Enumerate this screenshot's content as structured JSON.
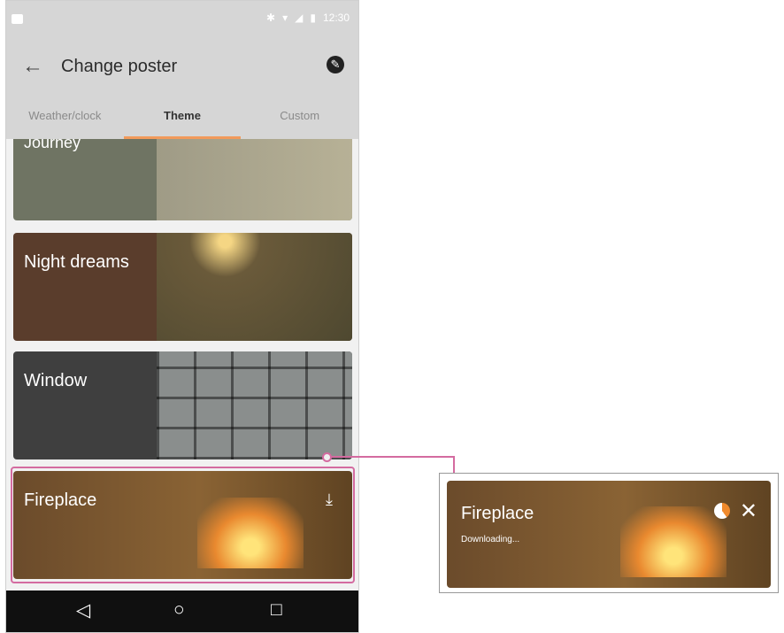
{
  "status": {
    "time": "12:30",
    "icons": [
      "notification-icon",
      "bluetooth-icon",
      "wifi-icon",
      "signal-icon",
      "battery-icon"
    ]
  },
  "appbar": {
    "back_icon": "←",
    "title": "Change poster",
    "settings_icon": "wrench-icon"
  },
  "tabs": [
    {
      "label": "Weather/clock"
    },
    {
      "label": "Theme"
    },
    {
      "label": "Custom"
    }
  ],
  "themes": [
    {
      "label": "Journey"
    },
    {
      "label": "Night dreams"
    },
    {
      "label": "Window"
    },
    {
      "label": "Fireplace"
    }
  ],
  "actions": {
    "download_glyph": "⤓"
  },
  "navigation": {
    "back": "◁",
    "home": "○",
    "recents": "□"
  },
  "detail": {
    "title": "Fireplace",
    "subtitle": "Downloading...",
    "close_glyph": "✕"
  },
  "colors": {
    "callout": "#d46ba0",
    "active_tab": "#f29a5b",
    "progress": "#f08a2c"
  }
}
